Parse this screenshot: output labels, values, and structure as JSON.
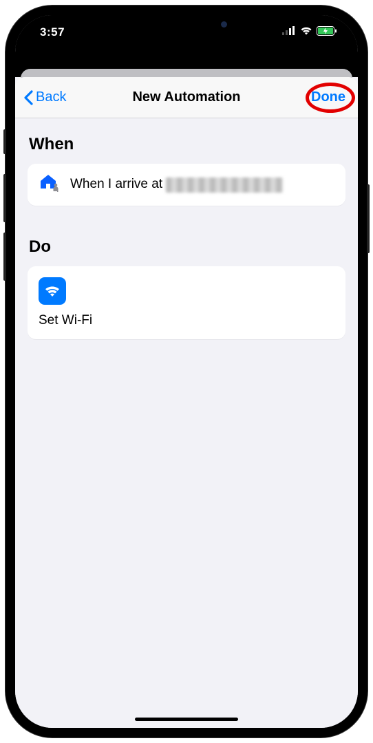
{
  "status": {
    "time": "3:57"
  },
  "nav": {
    "back_label": "Back",
    "title": "New Automation",
    "done_label": "Done"
  },
  "sections": {
    "when": {
      "header": "When",
      "item": {
        "text_prefix": "When I arrive at "
      }
    },
    "do": {
      "header": "Do",
      "item": {
        "label": "Set Wi-Fi"
      }
    }
  }
}
